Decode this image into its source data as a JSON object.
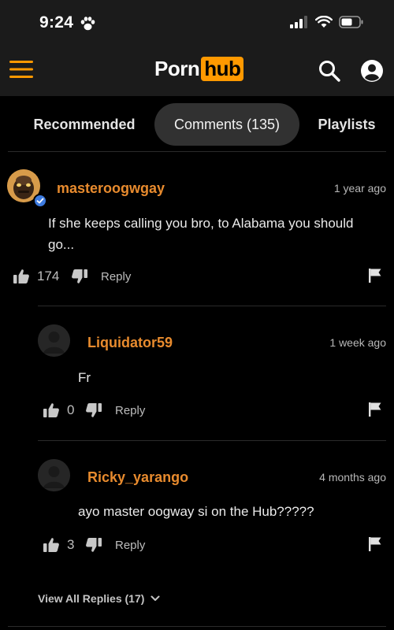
{
  "status_bar": {
    "time": "9:24",
    "icons": [
      "paw-icon",
      "signal-icon",
      "wifi-icon",
      "battery-icon"
    ]
  },
  "nav": {
    "logo_part1": "Porn",
    "logo_part2": "hub",
    "brand_color": "#ff9900",
    "icons": [
      "menu-icon",
      "search-icon",
      "user-icon"
    ]
  },
  "tabs": [
    {
      "label": "Recommended",
      "active": false
    },
    {
      "label": "Comments (135)",
      "active": true
    },
    {
      "label": "Playlists",
      "active": false
    }
  ],
  "comments": [
    {
      "username": "masteroogwgay",
      "time": "1 year ago",
      "text": "If she keeps calling you bro, to Alabama you should go...",
      "likes": "174",
      "reply_label": "Reply",
      "verified": true
    },
    {
      "username": "Liquidator59",
      "time": "1 week ago",
      "text": "Fr",
      "likes": "0",
      "reply_label": "Reply",
      "verified": false
    },
    {
      "username": "Ricky_yarango",
      "time": "4 months ago",
      "text": "ayo master oogway si on the Hub?????",
      "likes": "3",
      "reply_label": "Reply",
      "verified": false
    }
  ],
  "view_replies_label": "View All Replies (17)",
  "colors": {
    "username": "#e88b2e",
    "background": "#000000",
    "active_tab": "#313131",
    "verified": "#3d7be0"
  }
}
